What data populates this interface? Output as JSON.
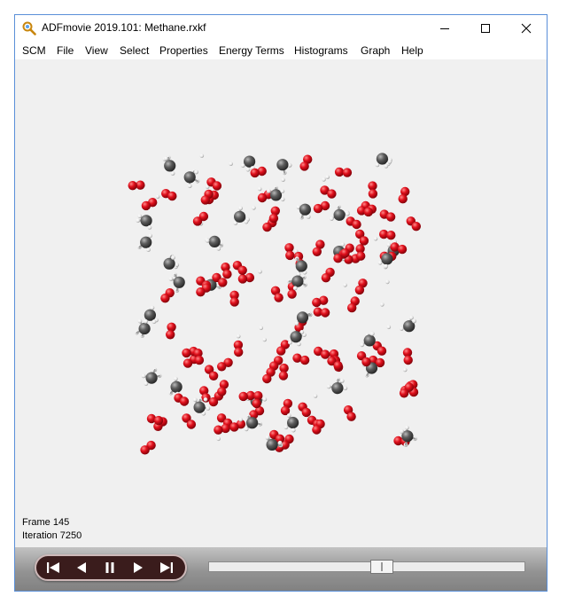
{
  "window": {
    "title": "ADFmovie 2019.101: Methane.rxkf"
  },
  "menu": [
    "SCM",
    "File",
    "View",
    "Select",
    "Properties",
    "Energy Terms",
    "Histograms",
    "Graph",
    "Help"
  ],
  "status": {
    "frame": "Frame 145",
    "iteration": "Iteration 7250"
  },
  "playback": {
    "slider_fraction": 0.55
  },
  "colors": {
    "oxygen": "#e0101c",
    "carbon": "#5c5c5c",
    "hydrogen": "#e8e8e8",
    "controls_pill": "#3a1c1c"
  },
  "icons": [
    "app-logo-icon",
    "minimize-icon",
    "maximize-icon",
    "close-icon",
    "skip-to-start-icon",
    "step-back-icon",
    "pause-icon",
    "play-icon",
    "skip-to-end-icon"
  ]
}
